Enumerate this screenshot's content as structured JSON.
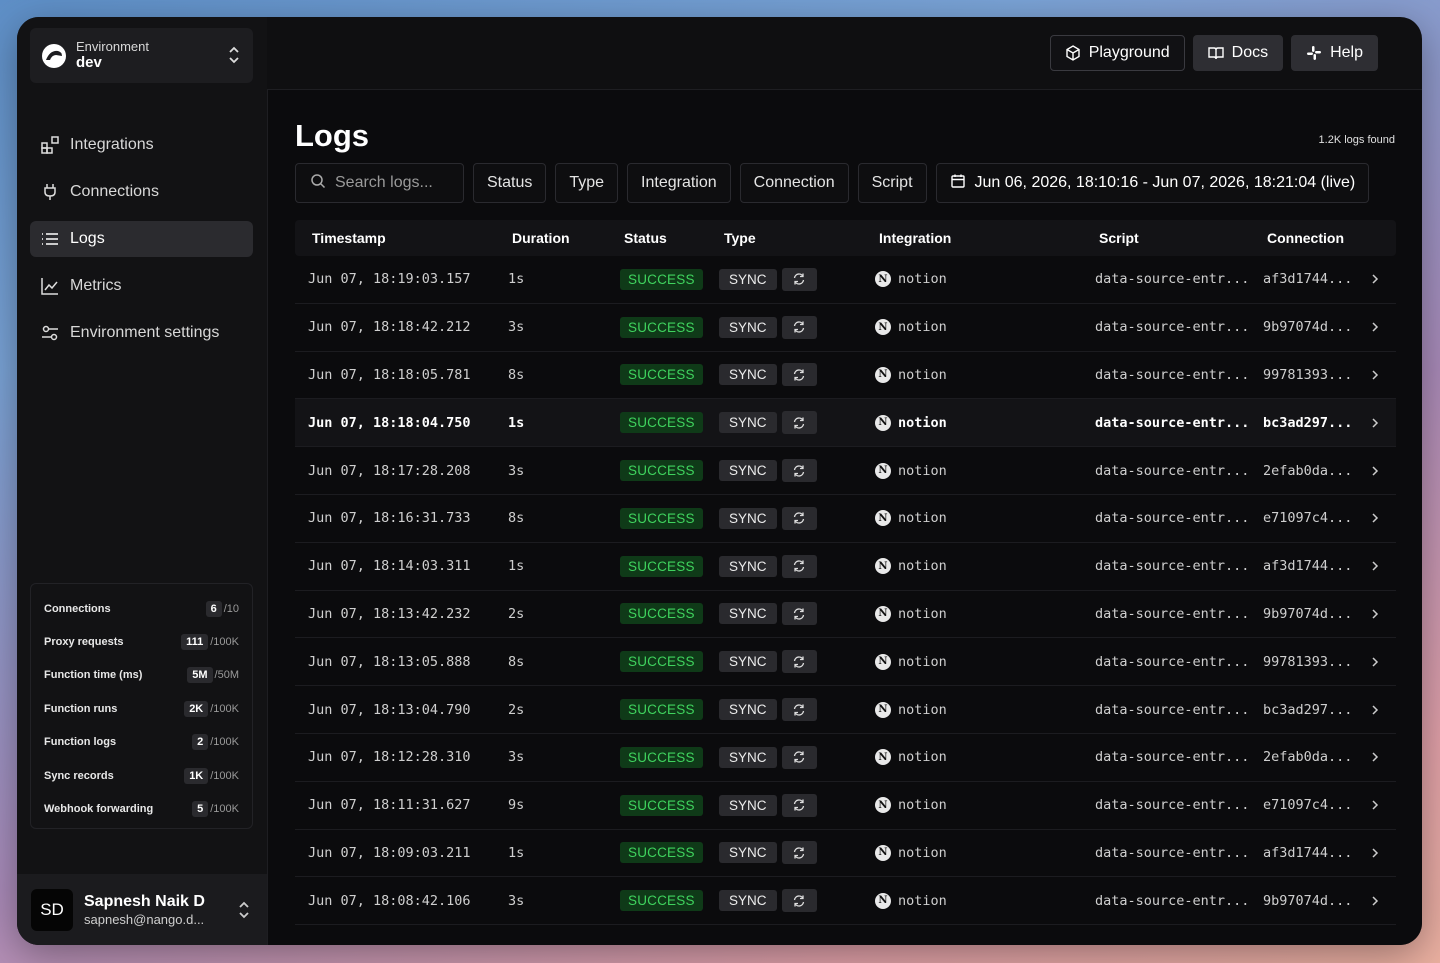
{
  "environment": {
    "label": "Environment",
    "value": "dev"
  },
  "nav": [
    {
      "label": "Integrations",
      "icon": "integrations-icon",
      "active": false
    },
    {
      "label": "Connections",
      "icon": "plug-icon",
      "active": false
    },
    {
      "label": "Logs",
      "icon": "list-icon",
      "active": true
    },
    {
      "label": "Metrics",
      "icon": "chart-icon",
      "active": false
    },
    {
      "label": "Environment settings",
      "icon": "settings-sliders-icon",
      "active": false
    }
  ],
  "usage": [
    {
      "label": "Connections",
      "value": "6",
      "limit": "/10"
    },
    {
      "label": "Proxy requests",
      "value": "111",
      "limit": "/100K"
    },
    {
      "label": "Function time (ms)",
      "value": "5M",
      "limit": "/50M"
    },
    {
      "label": "Function runs",
      "value": "2K",
      "limit": "/100K"
    },
    {
      "label": "Function logs",
      "value": "2",
      "limit": "/100K"
    },
    {
      "label": "Sync records",
      "value": "1K",
      "limit": "/100K"
    },
    {
      "label": "Webhook forwarding",
      "value": "5",
      "limit": "/100K"
    }
  ],
  "user": {
    "initials": "SD",
    "name": "Sapnesh Naik D",
    "email": "sapnesh@nango.d..."
  },
  "topbar": {
    "playground": "Playground",
    "docs": "Docs",
    "help": "Help"
  },
  "page": {
    "title": "Logs",
    "count": "1.2K logs found"
  },
  "filters": {
    "search_placeholder": "Search logs...",
    "status": "Status",
    "type": "Type",
    "integration": "Integration",
    "connection": "Connection",
    "script": "Script",
    "date_range": "Jun 06, 2026, 18:10:16 - Jun 07, 2026, 18:21:04 (live)"
  },
  "table": {
    "columns": [
      "Timestamp",
      "Duration",
      "Status",
      "Type",
      "Integration",
      "Script",
      "Connection"
    ],
    "rows": [
      {
        "ts": "Jun 07, 18:19:03.157",
        "dur": "1s",
        "status": "SUCCESS",
        "type": "SYNC",
        "integration": "notion",
        "script": "data-source-entr...",
        "connection": "af3d1744..."
      },
      {
        "ts": "Jun 07, 18:18:42.212",
        "dur": "3s",
        "status": "SUCCESS",
        "type": "SYNC",
        "integration": "notion",
        "script": "data-source-entr...",
        "connection": "9b97074d..."
      },
      {
        "ts": "Jun 07, 18:18:05.781",
        "dur": "8s",
        "status": "SUCCESS",
        "type": "SYNC",
        "integration": "notion",
        "script": "data-source-entr...",
        "connection": "99781393..."
      },
      {
        "ts": "Jun 07, 18:18:04.750",
        "dur": "1s",
        "status": "SUCCESS",
        "type": "SYNC",
        "integration": "notion",
        "script": "data-source-entr...",
        "connection": "bc3ad297..."
      },
      {
        "ts": "Jun 07, 18:17:28.208",
        "dur": "3s",
        "status": "SUCCESS",
        "type": "SYNC",
        "integration": "notion",
        "script": "data-source-entr...",
        "connection": "2efab0da..."
      },
      {
        "ts": "Jun 07, 18:16:31.733",
        "dur": "8s",
        "status": "SUCCESS",
        "type": "SYNC",
        "integration": "notion",
        "script": "data-source-entr...",
        "connection": "e71097c4..."
      },
      {
        "ts": "Jun 07, 18:14:03.311",
        "dur": "1s",
        "status": "SUCCESS",
        "type": "SYNC",
        "integration": "notion",
        "script": "data-source-entr...",
        "connection": "af3d1744..."
      },
      {
        "ts": "Jun 07, 18:13:42.232",
        "dur": "2s",
        "status": "SUCCESS",
        "type": "SYNC",
        "integration": "notion",
        "script": "data-source-entr...",
        "connection": "9b97074d..."
      },
      {
        "ts": "Jun 07, 18:13:05.888",
        "dur": "8s",
        "status": "SUCCESS",
        "type": "SYNC",
        "integration": "notion",
        "script": "data-source-entr...",
        "connection": "99781393..."
      },
      {
        "ts": "Jun 07, 18:13:04.790",
        "dur": "2s",
        "status": "SUCCESS",
        "type": "SYNC",
        "integration": "notion",
        "script": "data-source-entr...",
        "connection": "bc3ad297..."
      },
      {
        "ts": "Jun 07, 18:12:28.310",
        "dur": "3s",
        "status": "SUCCESS",
        "type": "SYNC",
        "integration": "notion",
        "script": "data-source-entr...",
        "connection": "2efab0da..."
      },
      {
        "ts": "Jun 07, 18:11:31.627",
        "dur": "9s",
        "status": "SUCCESS",
        "type": "SYNC",
        "integration": "notion",
        "script": "data-source-entr...",
        "connection": "e71097c4..."
      },
      {
        "ts": "Jun 07, 18:09:03.211",
        "dur": "1s",
        "status": "SUCCESS",
        "type": "SYNC",
        "integration": "notion",
        "script": "data-source-entr...",
        "connection": "af3d1744..."
      },
      {
        "ts": "Jun 07, 18:08:42.106",
        "dur": "3s",
        "status": "SUCCESS",
        "type": "SYNC",
        "integration": "notion",
        "script": "data-source-entr...",
        "connection": "9b97074d..."
      }
    ],
    "highlighted_row": 3
  },
  "colors": {
    "success_bg": "#0f3a18",
    "success_fg": "#3fd35e",
    "accent": "#2b2b2f"
  }
}
